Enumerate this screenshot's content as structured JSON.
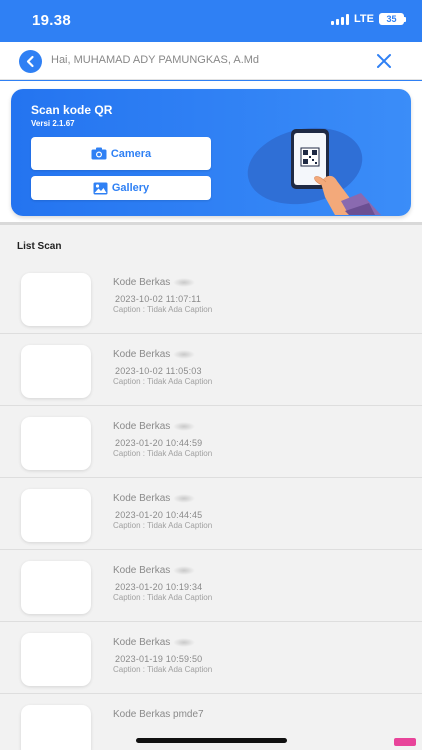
{
  "status_bar": {
    "time": "19.38",
    "network": "LTE",
    "battery": "35"
  },
  "header": {
    "greeting": "Hai, MUHAMAD ADY PAMUNGKAS, A.Md",
    "back_icon": "chevron-left-icon",
    "close_icon": "close-icon"
  },
  "banner": {
    "title": "Scan kode QR",
    "version": "Versi 2.1.67",
    "camera_label": "Camera",
    "gallery_label": "Gallery",
    "illustration": "phone-qr-scan-illustration"
  },
  "list": {
    "title": "List Scan",
    "items": [
      {
        "code_label": "Kode Berkas",
        "date": "2023-10-02 11:07:11",
        "caption": "Caption : Tidak Ada Caption"
      },
      {
        "code_label": "Kode Berkas",
        "date": "2023-10-02 11:05:03",
        "caption": "Caption : Tidak Ada Caption"
      },
      {
        "code_label": "Kode Berkas",
        "date": "2023-01-20 10:44:59",
        "caption": "Caption : Tidak Ada Caption"
      },
      {
        "code_label": "Kode Berkas",
        "date": "2023-01-20 10:44:45",
        "caption": "Caption : Tidak Ada Caption"
      },
      {
        "code_label": "Kode Berkas",
        "date": "2023-01-20 10:19:34",
        "caption": "Caption : Tidak Ada Caption"
      },
      {
        "code_label": "Kode Berkas",
        "date": "2023-01-19 10:59:50",
        "caption": "Caption : Tidak Ada Caption"
      },
      {
        "code_label": "Kode Berkas pmde7",
        "date": "",
        "caption": ""
      }
    ]
  },
  "colors": {
    "primary": "#2f80f4",
    "background": "#f2f2f2"
  }
}
